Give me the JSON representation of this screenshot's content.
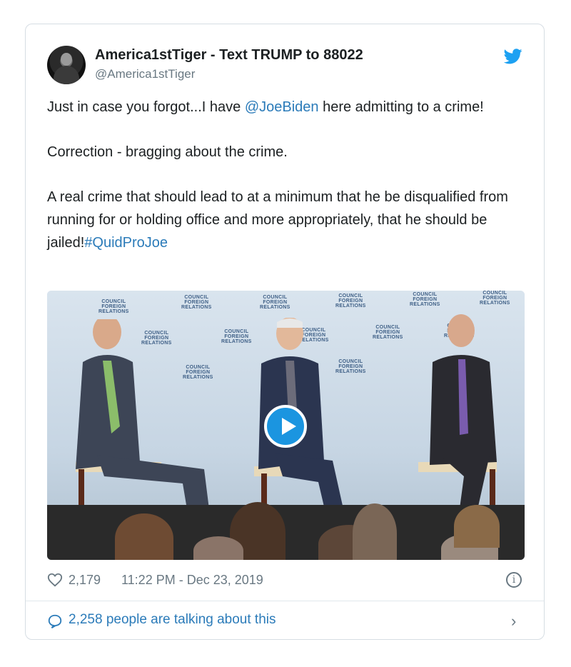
{
  "tweet": {
    "display_name": "America1stTiger - Text TRUMP to 88022",
    "handle": "@America1stTiger",
    "paragraph1_pre": "Just in case you forgot...I have ",
    "mention": "@JoeBiden",
    "paragraph1_post": " here admitting to a crime!",
    "paragraph2": "Correction - bragging about the crime.",
    "paragraph3": "A real crime that should lead to at a minimum that he be disqualified from running for or holding office and more appropriately, that he should be jailed!",
    "hashtag": "#QuidProJoe"
  },
  "media": {
    "backdrop_text": "COUNCIL FOREIGN RELATIONS"
  },
  "meta": {
    "likes": "2,179",
    "timestamp": "11:22 PM - Dec 23, 2019",
    "info_icon_glyph": "i"
  },
  "footer": {
    "talk_text": "2,258 people are talking about this",
    "chevron": "›"
  },
  "colors": {
    "link": "#2b7bb9",
    "twitter_blue": "#1da1f2",
    "play_button": "#1b95e0"
  },
  "icons": [
    "twitter-bird-icon",
    "heart-icon",
    "info-icon",
    "speech-bubble-icon",
    "chevron-right-icon",
    "play-icon"
  ]
}
